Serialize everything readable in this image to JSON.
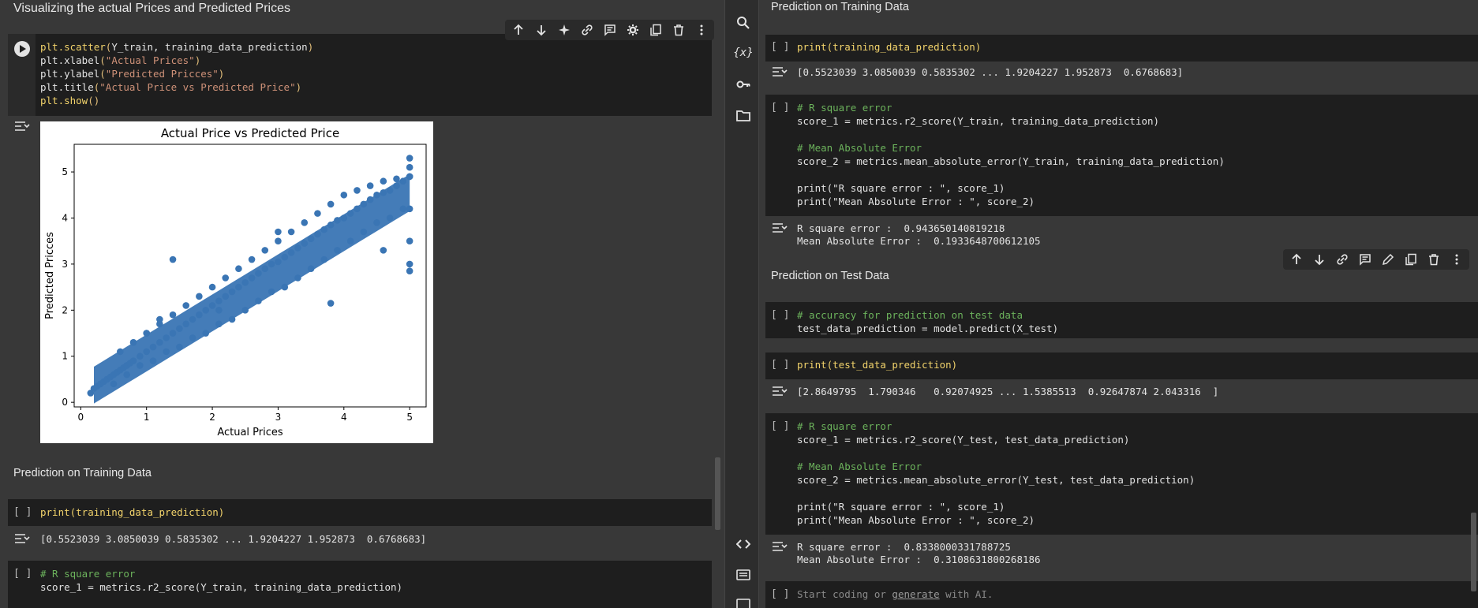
{
  "left": {
    "heading_top": "Visualizing the actual Prices and Predicted Prices",
    "plot_cell": {
      "lines": [
        "plt.scatter(Y_train, training_data_prediction)",
        "plt.xlabel(\"Actual Prices\")",
        "plt.ylabel(\"Predicted Pricces\")",
        "plt.title(\"Actual Price vs Predicted Price\")",
        "plt.show()"
      ]
    },
    "heading_training": "Prediction on Training Data",
    "print_cell": {
      "bracket": "[ ]",
      "code": "print(training_data_prediction)"
    },
    "print_output": "[0.5523039 3.0850039 0.5835302 ... 1.9204227 1.952873  0.6768683]",
    "rsq_cell": {
      "bracket": "[ ]",
      "line1": "# R square error",
      "line2": "score_1 = metrics.r2_score(Y_train, training_data_prediction)"
    }
  },
  "right": {
    "heading_training": "Prediction on Training Data",
    "print_train_cell": {
      "bracket": "[ ]",
      "code": "print(training_data_prediction)"
    },
    "print_train_output": "[0.5523039 3.0850039 0.5835302 ... 1.9204227 1.952873  0.6768683]",
    "train_metrics_cell": {
      "bracket": "[ ]",
      "lines": [
        "# R square error",
        "score_1 = metrics.r2_score(Y_train, training_data_prediction)",
        "",
        "# Mean Absolute Error",
        "score_2 = metrics.mean_absolute_error(Y_train, training_data_prediction)",
        "",
        "print(\"R square error : \", score_1)",
        "print(\"Mean Absolute Error : \", score_2)"
      ]
    },
    "train_metrics_output": [
      "R square error :  0.943650140819218",
      "Mean Absolute Error :  0.1933648700612105"
    ],
    "heading_test": "Prediction on Test Data",
    "test_pred_cell": {
      "bracket": "[ ]",
      "line1": "# accuracy for prediction on test data",
      "line2": "test_data_prediction = model.predict(X_test)"
    },
    "print_test_cell": {
      "bracket": "[ ]",
      "code": "print(test_data_prediction)"
    },
    "print_test_output": "[2.8649795  1.790346   0.92074925 ... 1.5385513  0.92647874 2.043316  ]",
    "test_metrics_cell": {
      "bracket": "[ ]",
      "lines": [
        "# R square error",
        "score_1 = metrics.r2_score(Y_test, test_data_prediction)",
        "",
        "# Mean Absolute Error",
        "score_2 = metrics.mean_absolute_error(Y_test, test_data_prediction)",
        "",
        "print(\"R square error : \", score_1)",
        "print(\"Mean Absolute Error : \", score_2)"
      ]
    },
    "test_metrics_output": [
      "R square error :  0.8338000331788725",
      "Mean Absolute Error :  0.3108631800268186"
    ],
    "empty_cell": {
      "bracket": "[ ]",
      "pre": "Start coding or ",
      "link": "generate",
      "post": " with AI."
    }
  },
  "icons": {
    "toolbar_left": [
      "arrow-up-icon",
      "arrow-down-icon",
      "sparkle-icon",
      "link-icon",
      "comment-icon",
      "gear-icon",
      "mirror-cell-icon",
      "trash-icon",
      "more-vert-icon"
    ],
    "toolbar_right": [
      "arrow-up-icon",
      "arrow-down-icon",
      "link-icon",
      "comment-icon",
      "pencil-icon",
      "mirror-cell-icon",
      "trash-icon",
      "more-vert-icon"
    ],
    "sidebar": [
      "search-icon",
      "variables-icon",
      "key-icon",
      "folder-icon",
      "code-icon",
      "terminal-icon"
    ],
    "sidebar_variables_label": "{x}"
  },
  "colors": {
    "background": "#383838",
    "cell": "#1e1e1e",
    "accent_scatter": "#3a75b4"
  },
  "chart_data": {
    "type": "scatter",
    "title": "Actual Price vs Predicted Price",
    "xlabel": "Actual Prices",
    "ylabel": "Predicted Pricces",
    "xlim": [
      -0.1,
      5.25
    ],
    "ylim": [
      -0.1,
      5.6
    ],
    "xticks": [
      0,
      1,
      2,
      3,
      4,
      5
    ],
    "yticks": [
      0,
      1,
      2,
      3,
      4,
      5
    ],
    "color": "#3a75b4",
    "series": [
      {
        "x": [
          0.15,
          0.2,
          0.25,
          0.3,
          0.35,
          0.4,
          0.45,
          0.5,
          0.55,
          0.6,
          0.65,
          0.7,
          0.75,
          0.8,
          0.9,
          1.0,
          1.1,
          1.2,
          1.3,
          1.4,
          1.5,
          1.6,
          1.7,
          1.8,
          1.9,
          2.0,
          2.1,
          2.2,
          2.3,
          2.4,
          2.5,
          2.6,
          2.7,
          2.8,
          2.9,
          3.0,
          3.1,
          3.2,
          3.3,
          3.4,
          3.5,
          3.6,
          3.7,
          3.8,
          3.9,
          4.0,
          4.1,
          4.2,
          4.3,
          4.4,
          4.5,
          4.6,
          4.7,
          4.8,
          4.9,
          5.0,
          0.6,
          0.8,
          1.0,
          1.2,
          1.4,
          1.6,
          1.8,
          2.0,
          2.2,
          2.4,
          2.6,
          2.8,
          3.0,
          3.2,
          3.4,
          3.6,
          3.8,
          4.0,
          4.2,
          4.4,
          4.6,
          4.8,
          5.0,
          0.5,
          0.7,
          0.9,
          1.1,
          1.3,
          1.5,
          1.7,
          1.9,
          2.1,
          2.3,
          2.5,
          2.7,
          2.9,
          3.1,
          3.3,
          3.5,
          3.7,
          3.9,
          4.1,
          4.3,
          4.5,
          4.7,
          4.9,
          1.4,
          2.1,
          3.8,
          5.0,
          5.0,
          5.0,
          5.0,
          5.0,
          5.0,
          1.2,
          1.0,
          4.6,
          3.0
        ],
        "y": [
          0.2,
          0.3,
          0.35,
          0.4,
          0.45,
          0.5,
          0.55,
          0.6,
          0.65,
          0.7,
          0.75,
          0.8,
          0.85,
          0.9,
          1.0,
          1.1,
          1.2,
          1.3,
          1.4,
          1.5,
          1.6,
          1.7,
          1.8,
          1.9,
          2.0,
          2.1,
          2.2,
          2.3,
          2.4,
          2.5,
          2.6,
          2.7,
          2.8,
          2.9,
          3.0,
          3.05,
          3.15,
          3.25,
          3.35,
          3.45,
          3.55,
          3.65,
          3.75,
          3.85,
          3.95,
          4.0,
          4.1,
          4.2,
          4.3,
          4.4,
          4.5,
          4.55,
          4.6,
          4.7,
          4.8,
          4.9,
          1.1,
          1.3,
          1.5,
          1.7,
          1.9,
          2.1,
          2.3,
          2.5,
          2.7,
          2.9,
          3.1,
          3.3,
          3.5,
          3.7,
          3.9,
          4.1,
          4.3,
          4.5,
          4.6,
          4.7,
          4.8,
          4.85,
          4.9,
          0.4,
          0.6,
          0.8,
          0.9,
          1.1,
          1.2,
          1.4,
          1.5,
          1.7,
          1.8,
          2.0,
          2.2,
          2.4,
          2.5,
          2.7,
          2.9,
          3.1,
          3.3,
          3.5,
          3.7,
          3.9,
          4.0,
          4.2,
          3.1,
          2.0,
          2.15,
          5.3,
          5.1,
          3.0,
          2.85,
          4.2,
          3.5,
          1.8,
          1.5,
          3.3,
          3.7
        ]
      }
    ]
  }
}
